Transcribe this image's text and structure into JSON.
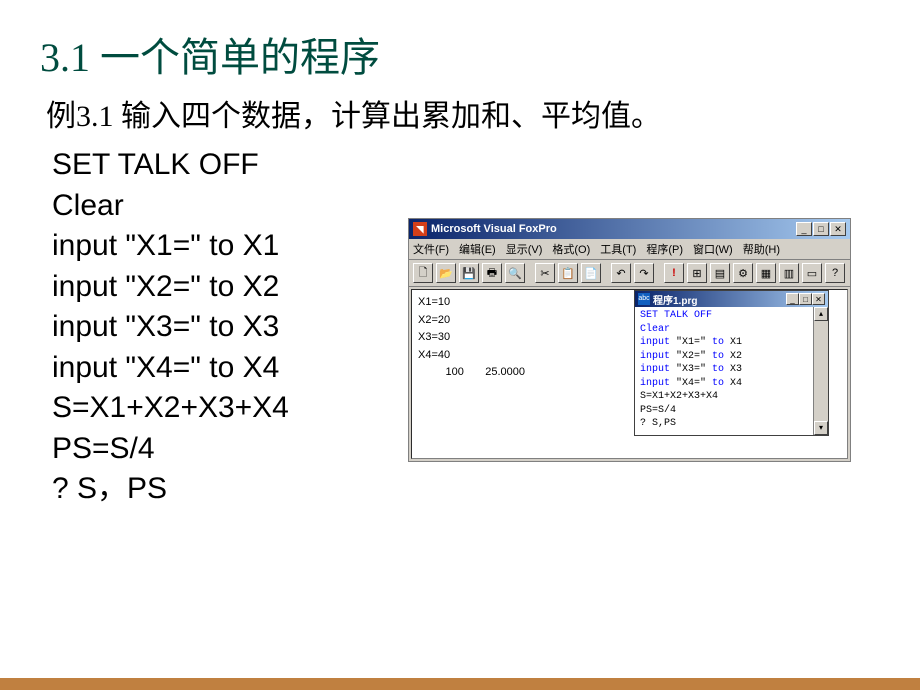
{
  "title": "3.1  一个简单的程序",
  "subtitle": "例3.1 输入四个数据，计算出累加和、平均值。",
  "code_lines": [
    "SET TALK OFF",
    "Clear",
    "input \"X1=\" to X1",
    "input \"X2=\" to X2",
    "input \"X3=\" to X3",
    "input \"X4=\" to X4",
    "S=X1+X2+X3+X4",
    "PS=S/4",
    "? S，PS"
  ],
  "vfp": {
    "title": "Microsoft Visual FoxPro",
    "menu": {
      "file": "文件(F)",
      "edit": "编辑(E)",
      "view": "显示(V)",
      "format": "格式(O)",
      "tools": "工具(T)",
      "program": "程序(P)",
      "window": "窗口(W)",
      "help": "帮助(H)"
    },
    "output": {
      "l1": "X1=10",
      "l2": "X2=20",
      "l3": "X3=30",
      "l4": "X4=40",
      "l5": "         100       25.0000"
    },
    "code_window": {
      "title": "程序1.prg",
      "lines": {
        "l1": "SET TALK OFF",
        "l2": "Clear",
        "l3a": "input",
        "l3b": " \"X1=\" ",
        "l3c": "to",
        "l3d": " X1",
        "l4a": "input",
        "l4b": " \"X2=\" ",
        "l4c": "to",
        "l4d": " X2",
        "l5a": "input",
        "l5b": " \"X3=\" ",
        "l5c": "to",
        "l5d": " X3",
        "l6a": "input",
        "l6b": " \"X4=\" ",
        "l6c": "to",
        "l6d": " X4",
        "l7": "S=X1+X2+X3+X4",
        "l8": "PS=S/4",
        "l9": "? S,PS"
      }
    },
    "controls": {
      "min": "_",
      "max": "□",
      "close": "✕"
    }
  }
}
